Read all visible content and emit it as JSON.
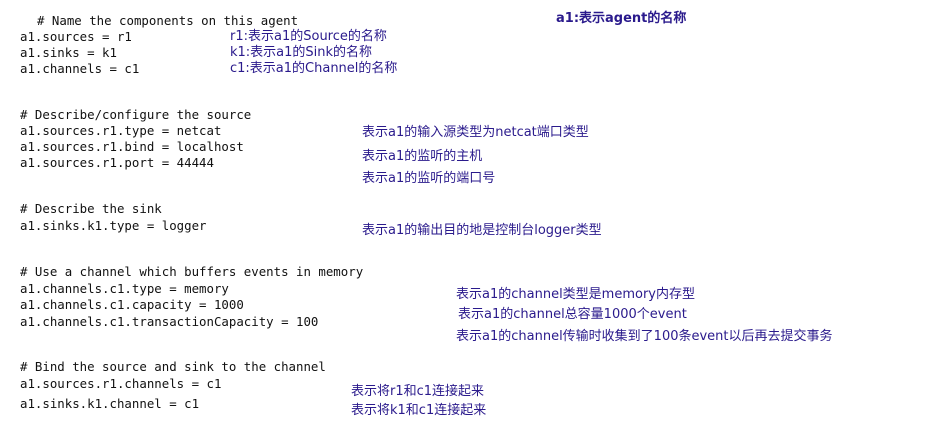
{
  "code_lines": [
    "# Name the components on this agent",
    "a1.sources = r1",
    "a1.sinks = k1",
    "a1.channels = c1",
    "# Describe/configure the source",
    "a1.sources.r1.type = netcat",
    "a1.sources.r1.bind = localhost",
    "a1.sources.r1.port = 44444",
    "# Describe the sink",
    "a1.sinks.k1.type = logger",
    "# Use a channel which buffers events in memory",
    "a1.channels.c1.type = memory",
    "a1.channels.c1.capacity = 1000",
    "a1.channels.c1.transactionCapacity = 100",
    "# Bind the source and sink to the channel",
    "a1.sources.r1.channels = c1",
    "a1.sinks.k1.channel = c1"
  ],
  "annotations": [
    "a1:表示agent的名称",
    "r1:表示a1的Source的名称",
    "k1:表示a1的Sink的名称",
    "c1:表示a1的Channel的名称",
    "表示a1的输入源类型为netcat端口类型",
    "表示a1的监听的主机",
    "表示a1的监听的端口号",
    "表示a1的输出目的地是控制台logger类型",
    "表示a1的channel类型是memory内存型",
    "表示a1的channel总容量1000个event",
    "表示a1的channel传输时收集到了100条event以后再去提交事务",
    "表示将r1和c1连接起来",
    "表示将k1和c1连接起来"
  ],
  "colors": {
    "code_text": "#111111",
    "annotation_text": "#2a1a8c",
    "background": "#ffffff"
  }
}
